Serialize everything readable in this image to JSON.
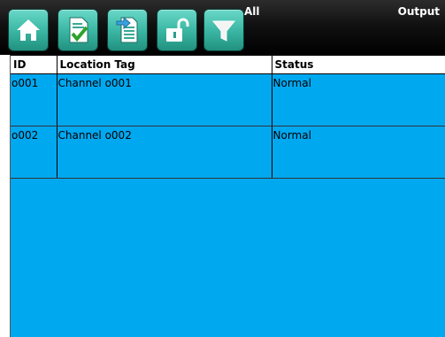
{
  "toolbar": {
    "buttons": [
      {
        "icon": "home-icon"
      },
      {
        "icon": "check-document-icon"
      },
      {
        "icon": "document-arrow-icon"
      },
      {
        "icon": "unlock-icon"
      },
      {
        "icon": "filter-icon"
      }
    ],
    "filter_label": "All",
    "title": "Output",
    "button_color": "#3cb8a5"
  },
  "grid": {
    "columns": [
      "ID",
      "Location Tag",
      "Status"
    ],
    "rows": [
      {
        "id": "o001",
        "location": "Channel o001",
        "status": "Normal"
      },
      {
        "id": "o002",
        "location": "Channel o002",
        "status": "Normal"
      }
    ],
    "row_color": "#00a8f0"
  }
}
